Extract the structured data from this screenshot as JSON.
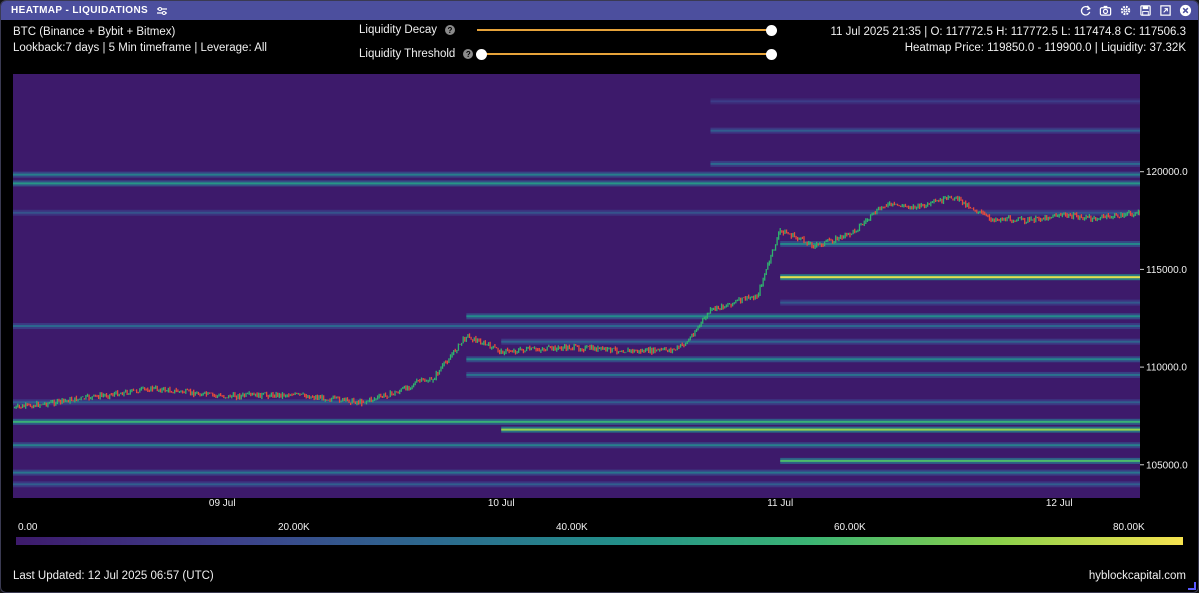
{
  "window": {
    "title": "HEATMAP - LIQUIDATIONS",
    "icons": [
      "settings-sliders-icon",
      "refresh-icon",
      "camera-icon",
      "gear-icon",
      "save-icon",
      "expand-icon",
      "close-icon"
    ]
  },
  "info": {
    "symbol": "BTC (Binance + Bybit + Bitmex)",
    "lookback": "Lookback:7 days | 5 Min timeframe | Leverage: All",
    "ohlc": "11 Jul 2025 21:35 | O: 117772.5 H: 117772.5 L: 117474.8 C: 117506.3",
    "heatmap_info": "Heatmap Price: 119850.0 - 119900.0 | Liquidity: 37.32K"
  },
  "controls": {
    "decay_label": "Liquidity Decay",
    "threshold_label": "Liquidity Threshold",
    "decay_value": 1.0,
    "threshold_range": [
      0.0,
      1.0
    ]
  },
  "colorbar": {
    "labels": [
      "0.00",
      "20.00K",
      "40.00K",
      "60.00K",
      "80.00K"
    ],
    "min": 0,
    "max": 84000
  },
  "footer": {
    "last_updated": "Last Updated: 12 Jul 2025 06:57 (UTC)",
    "brand": "hyblockcapital.com"
  },
  "colors": {
    "titlebar": "#4c4f9e",
    "background": "#3d1a6b",
    "candle_up": "#2fb36e",
    "candle_down": "#e64a3b",
    "slider_track": "#e6a33a"
  },
  "chart_data": {
    "type": "heatmap",
    "title": "",
    "xlabel": "",
    "ylabel": "",
    "x_ticks": [
      "09 Jul",
      "10 Jul",
      "11 Jul",
      "12 Jul"
    ],
    "y_ticks": [
      105000,
      110000,
      115000,
      120000
    ],
    "y_tick_labels": [
      "105000.0",
      "110000.0",
      "115000.0",
      "120000.0"
    ],
    "ylim": [
      103300,
      125000
    ],
    "xlim": [
      "2025-07-08 06:00",
      "2025-07-12 06:57"
    ],
    "price_series": {
      "name": "BTC",
      "x": [
        "2025-07-08 06:00",
        "2025-07-08 12:00",
        "2025-07-08 18:00",
        "2025-07-09 00:00",
        "2025-07-09 06:00",
        "2025-07-09 12:00",
        "2025-07-09 15:00",
        "2025-07-09 17:00",
        "2025-07-09 18:00",
        "2025-07-09 21:00",
        "2025-07-10 00:00",
        "2025-07-10 06:00",
        "2025-07-10 12:00",
        "2025-07-10 15:00",
        "2025-07-10 16:00",
        "2025-07-10 18:00",
        "2025-07-10 21:00",
        "2025-07-10 22:00",
        "2025-07-11 00:00",
        "2025-07-11 03:00",
        "2025-07-11 06:00",
        "2025-07-11 09:00",
        "2025-07-11 12:00",
        "2025-07-11 15:00",
        "2025-07-11 18:00",
        "2025-07-11 21:35",
        "2025-07-12 00:00",
        "2025-07-12 03:00",
        "2025-07-12 06:57"
      ],
      "y": [
        107900,
        108400,
        108900,
        108500,
        108600,
        108200,
        108700,
        109300,
        109300,
        111600,
        110800,
        111000,
        110800,
        110900,
        111300,
        112900,
        113500,
        113600,
        117000,
        116200,
        116800,
        118300,
        118200,
        118700,
        117600,
        117500,
        117800,
        117600,
        117900
      ]
    },
    "liquidity_bands": [
      {
        "price": 123600,
        "value": 14000,
        "from": "2025-07-10 18:00"
      },
      {
        "price": 122100,
        "value": 26000,
        "from": "2025-07-10 18:00"
      },
      {
        "price": 120400,
        "value": 30000,
        "from": "2025-07-10 18:00"
      },
      {
        "price": 119850,
        "value": 37320,
        "from": "2025-07-08 06:00"
      },
      {
        "price": 119400,
        "value": 46000,
        "from": "2025-07-08 06:00"
      },
      {
        "price": 117900,
        "value": 22000,
        "from": "2025-07-08 06:00"
      },
      {
        "price": 116300,
        "value": 40000,
        "from": "2025-07-11 00:00"
      },
      {
        "price": 114600,
        "value": 82000,
        "from": "2025-07-11 00:00"
      },
      {
        "price": 113300,
        "value": 24000,
        "from": "2025-07-11 00:00"
      },
      {
        "price": 112600,
        "value": 42000,
        "from": "2025-07-09 21:00"
      },
      {
        "price": 112100,
        "value": 30000,
        "from": "2025-07-08 06:00"
      },
      {
        "price": 111300,
        "value": 28000,
        "from": "2025-07-10 00:00"
      },
      {
        "price": 110400,
        "value": 40000,
        "from": "2025-07-09 21:00"
      },
      {
        "price": 109600,
        "value": 33000,
        "from": "2025-07-09 21:00"
      },
      {
        "price": 108200,
        "value": 26000,
        "from": "2025-07-08 06:00"
      },
      {
        "price": 107200,
        "value": 56000,
        "from": "2025-07-08 06:00"
      },
      {
        "price": 106800,
        "value": 72000,
        "from": "2025-07-10 00:00"
      },
      {
        "price": 106000,
        "value": 38000,
        "from": "2025-07-08 06:00"
      },
      {
        "price": 105200,
        "value": 60000,
        "from": "2025-07-11 00:00"
      },
      {
        "price": 104600,
        "value": 34000,
        "from": "2025-07-08 06:00"
      },
      {
        "price": 104000,
        "value": 26000,
        "from": "2025-07-08 06:00"
      }
    ]
  }
}
